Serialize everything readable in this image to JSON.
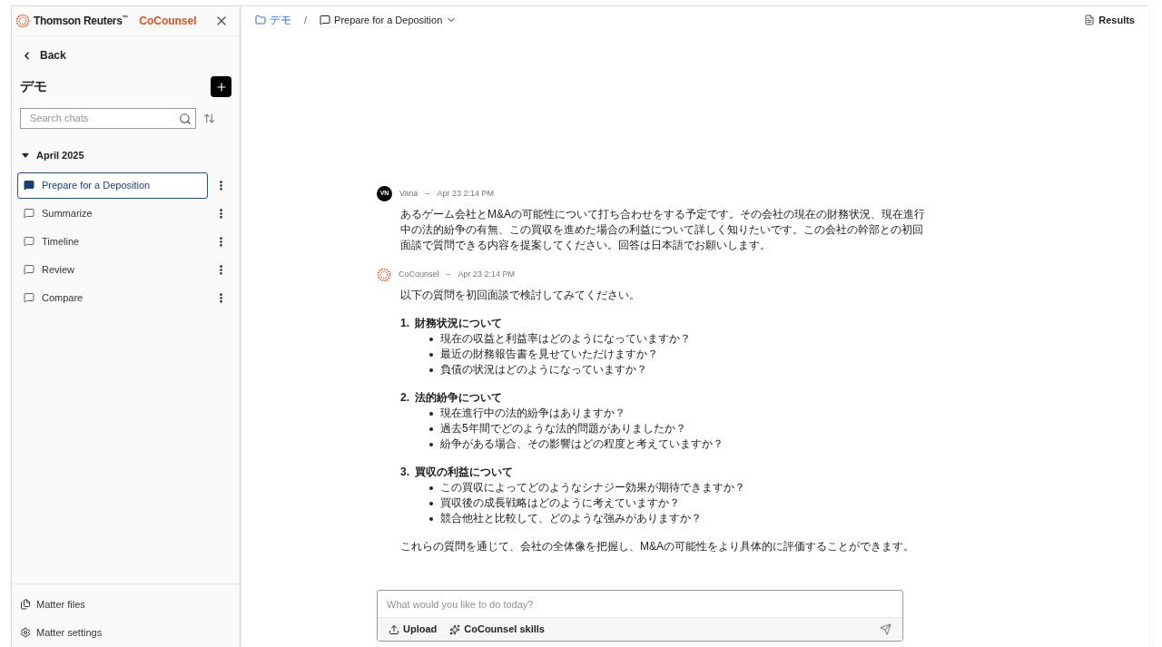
{
  "brand": {
    "company": "Thomson Reuters",
    "tm": "™",
    "product": "CoCounsel"
  },
  "sidebar": {
    "back": "Back",
    "title": "デモ",
    "search": {
      "placeholder": "Search chats"
    },
    "group": {
      "label": "April 2025",
      "expanded": true
    },
    "chats": [
      {
        "label": "Prepare for a Deposition",
        "selected": true
      },
      {
        "label": "Summarize",
        "selected": false
      },
      {
        "label": "Timeline",
        "selected": false
      },
      {
        "label": "Review",
        "selected": false
      },
      {
        "label": "Compare",
        "selected": false
      }
    ],
    "footer": [
      {
        "kind": "files",
        "label": "Matter files"
      },
      {
        "kind": "settings",
        "label": "Matter settings"
      }
    ]
  },
  "breadcrumb": {
    "folder": "デモ",
    "separator": "/",
    "chat": "Prepare for a Deposition"
  },
  "results": "Results",
  "messages": [
    {
      "kind": "user",
      "initials": "VN",
      "author": "Vana",
      "sep": "–",
      "time": "Apr 23 2:14 PM",
      "text": "あるゲーム会社とM&Aの可能性について打ち合わせをする予定です。その会社の現在の財務状況、現在進行中の法的紛争の有無、この買収を進めた場合の利益について詳しく知りたいです。この会社の幹部との初回面談で質問できる内容を提案してください。回答は日本語でお願いします。"
    },
    {
      "kind": "assistant",
      "author": "CoCounsel",
      "sep": "–",
      "time": "Apr 23 2:14 PM",
      "intro": "以下の質問を初回面談で検討してみてください。",
      "sections": [
        {
          "number": "1.",
          "heading": "財務状況について",
          "items": [
            "現在の収益と利益率はどのようになっていますか？",
            "最近の財務報告書を見せていただけますか？",
            "負債の状況はどのようになっていますか？"
          ]
        },
        {
          "number": "2.",
          "heading": "法的紛争について",
          "items": [
            "現在進行中の法的紛争はありますか？",
            "過去5年間でどのような法的問題がありましたか？",
            "紛争がある場合、その影響はどの程度と考えていますか？"
          ]
        },
        {
          "number": "3.",
          "heading": "買収の利益について",
          "items": [
            "この買収によってどのようなシナジー効果が期待できますか？",
            "買収後の成長戦略はどのように考えていますか？",
            "競合他社と比較して、どのような強みがありますか？"
          ]
        }
      ],
      "outro": "これらの質問を通じて、会社の全体像を把握し、M&Aの可能性をより具体的に評価することができます。"
    }
  ],
  "composer": {
    "placeholder": "What would you like to do today?",
    "upload": "Upload",
    "skills": "CoCounsel skills"
  }
}
